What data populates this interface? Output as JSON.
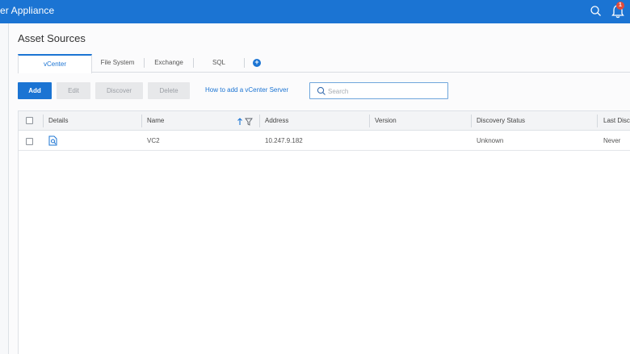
{
  "app": {
    "title": "er Appliance",
    "notification_count": "1"
  },
  "page": {
    "title": "Asset Sources"
  },
  "tabs": [
    {
      "label": "vCenter",
      "active": true
    },
    {
      "label": "File System"
    },
    {
      "label": "Exchange"
    },
    {
      "label": "SQL"
    }
  ],
  "toolbar": {
    "add_label": "Add",
    "edit_label": "Edit",
    "discover_label": "Discover",
    "delete_label": "Delete",
    "help_link": "How to add a vCenter Server",
    "search_placeholder": "Search"
  },
  "table": {
    "columns": [
      "Details",
      "Name",
      "Address",
      "Version",
      "Discovery Status",
      "Last Disco"
    ],
    "rows": [
      {
        "name": "VC2",
        "address": "10.247.9.182",
        "version": "",
        "discovery_status": "Unknown",
        "last_discovery": "Never"
      }
    ]
  },
  "colors": {
    "accent": "#1b74d3",
    "badge": "#e14b3b"
  }
}
